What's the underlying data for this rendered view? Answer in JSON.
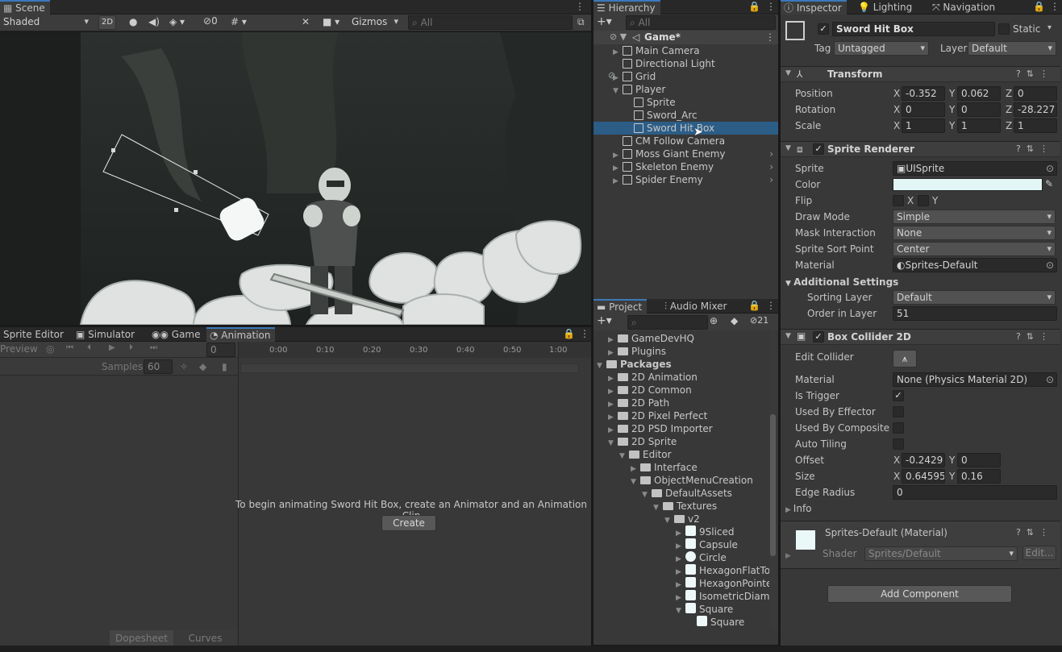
{
  "scene": {
    "tab": "Scene",
    "shading": "Shaded",
    "btn2d": "2D",
    "hidden_count": "0",
    "gizmos": "Gizmos",
    "search_placeholder": "All"
  },
  "bottom_tabs": [
    "Sprite Editor",
    "Simulator",
    "Game",
    "Animation"
  ],
  "animation": {
    "preview": "Preview",
    "frame": "0",
    "samples_label": "Samples",
    "samples": "60",
    "message": "To begin animating Sword Hit Box, create an Animator and an Animation Clip",
    "create": "Create",
    "dopesheet": "Dopesheet",
    "curves": "Curves",
    "ticks": [
      "0:00",
      "0:10",
      "0:20",
      "0:30",
      "0:40",
      "0:50",
      "1:00"
    ]
  },
  "hierarchy": {
    "tab": "Hierarchy",
    "search_placeholder": "All",
    "scene_name": "Game*",
    "items": [
      {
        "label": "Main Camera",
        "indent": 1,
        "arrow": "▶"
      },
      {
        "label": "Directional Light",
        "indent": 1,
        "arrow": ""
      },
      {
        "label": "Grid",
        "indent": 1,
        "arrow": "▶"
      },
      {
        "label": "Player",
        "indent": 1,
        "arrow": "▼"
      },
      {
        "label": "Sprite",
        "indent": 2,
        "arrow": ""
      },
      {
        "label": "Sword_Arc",
        "indent": 2,
        "arrow": ""
      },
      {
        "label": "Sword Hit Box",
        "indent": 2,
        "arrow": "",
        "selected": true
      },
      {
        "label": "CM Follow Camera",
        "indent": 1,
        "arrow": ""
      },
      {
        "label": "Moss Giant Enemy",
        "indent": 1,
        "arrow": "▶"
      },
      {
        "label": "Skeleton Enemy",
        "indent": 1,
        "arrow": "▶"
      },
      {
        "label": "Spider Enemy",
        "indent": 1,
        "arrow": "▶"
      }
    ]
  },
  "project": {
    "tab": "Project",
    "tab2": "Audio Mixer",
    "badge": "21",
    "items": [
      {
        "label": "GameDevHQ",
        "indent": 1,
        "arrow": "▶",
        "type": "folder"
      },
      {
        "label": "Plugins",
        "indent": 1,
        "arrow": "▶",
        "type": "folder"
      },
      {
        "label": "Packages",
        "indent": 0,
        "arrow": "▼",
        "type": "folder",
        "bold": true
      },
      {
        "label": "2D Animation",
        "indent": 1,
        "arrow": "▶",
        "type": "folder"
      },
      {
        "label": "2D Common",
        "indent": 1,
        "arrow": "▶",
        "type": "folder"
      },
      {
        "label": "2D Path",
        "indent": 1,
        "arrow": "▶",
        "type": "folder"
      },
      {
        "label": "2D Pixel Perfect",
        "indent": 1,
        "arrow": "▶",
        "type": "folder"
      },
      {
        "label": "2D PSD Importer",
        "indent": 1,
        "arrow": "▶",
        "type": "folder"
      },
      {
        "label": "2D Sprite",
        "indent": 1,
        "arrow": "▼",
        "type": "folder"
      },
      {
        "label": "Editor",
        "indent": 2,
        "arrow": "▼",
        "type": "folder"
      },
      {
        "label": "Interface",
        "indent": 3,
        "arrow": "▶",
        "type": "folder"
      },
      {
        "label": "ObjectMenuCreation",
        "indent": 3,
        "arrow": "▼",
        "type": "folder"
      },
      {
        "label": "DefaultAssets",
        "indent": 4,
        "arrow": "▼",
        "type": "folder"
      },
      {
        "label": "Textures",
        "indent": 5,
        "arrow": "▼",
        "type": "folder"
      },
      {
        "label": "v2",
        "indent": 6,
        "arrow": "▼",
        "type": "folder"
      },
      {
        "label": "9Sliced",
        "indent": 7,
        "arrow": "▶",
        "type": "sprite"
      },
      {
        "label": "Capsule",
        "indent": 7,
        "arrow": "▶",
        "type": "sprite"
      },
      {
        "label": "Circle",
        "indent": 7,
        "arrow": "▶",
        "type": "sprite"
      },
      {
        "label": "HexagonFlatTo",
        "indent": 7,
        "arrow": "▶",
        "type": "sprite"
      },
      {
        "label": "HexagonPointe",
        "indent": 7,
        "arrow": "▶",
        "type": "sprite"
      },
      {
        "label": "IsometricDiamo",
        "indent": 7,
        "arrow": "▶",
        "type": "sprite"
      },
      {
        "label": "Square",
        "indent": 7,
        "arrow": "▼",
        "type": "sprite"
      },
      {
        "label": "Square",
        "indent": 8,
        "arrow": "",
        "type": "sprite"
      }
    ]
  },
  "inspector": {
    "tabs": [
      "Inspector",
      "Lighting",
      "Navigation"
    ],
    "object_name": "Sword Hit Box",
    "static": "Static",
    "tag_label": "Tag",
    "tag": "Untagged",
    "layer_label": "Layer",
    "layer": "Default",
    "transform": {
      "title": "Transform",
      "position": {
        "x": "-0.352",
        "y": "0.062",
        "z": "0"
      },
      "rotation": {
        "x": "0",
        "y": "0",
        "z": "-28.227"
      },
      "scale": {
        "x": "1",
        "y": "1",
        "z": "1"
      },
      "labels": [
        "Position",
        "Rotation",
        "Scale"
      ]
    },
    "sprite_renderer": {
      "title": "Sprite Renderer",
      "sprite_label": "Sprite",
      "sprite": "UISprite",
      "color_label": "Color",
      "flip_label": "Flip",
      "flip_x": "X",
      "flip_y": "Y",
      "draw_mode_label": "Draw Mode",
      "draw_mode": "Simple",
      "mask_label": "Mask Interaction",
      "mask": "None",
      "sort_point_label": "Sprite Sort Point",
      "sort_point": "Center",
      "material_label": "Material",
      "material": "Sprites-Default",
      "additional": "Additional Settings",
      "sorting_layer_label": "Sorting Layer",
      "sorting_layer": "Default",
      "order_label": "Order in Layer",
      "order": "51"
    },
    "box_collider": {
      "title": "Box Collider 2D",
      "edit_label": "Edit Collider",
      "material_label": "Material",
      "material": "None (Physics Material 2D)",
      "trigger_label": "Is Trigger",
      "effector_label": "Used By Effector",
      "composite_label": "Used By Composite",
      "tiling_label": "Auto Tiling",
      "offset_label": "Offset",
      "offset_x": "-0.2429",
      "offset_y": "0",
      "size_label": "Size",
      "size_x": "0.64595",
      "size_y": "0.16",
      "radius_label": "Edge Radius",
      "radius": "0",
      "info_label": "Info"
    },
    "material_section": {
      "title": "Sprites-Default (Material)",
      "shader_label": "Shader",
      "shader": "Sprites/Default",
      "edit": "Edit..."
    },
    "add_component": "Add Component"
  }
}
